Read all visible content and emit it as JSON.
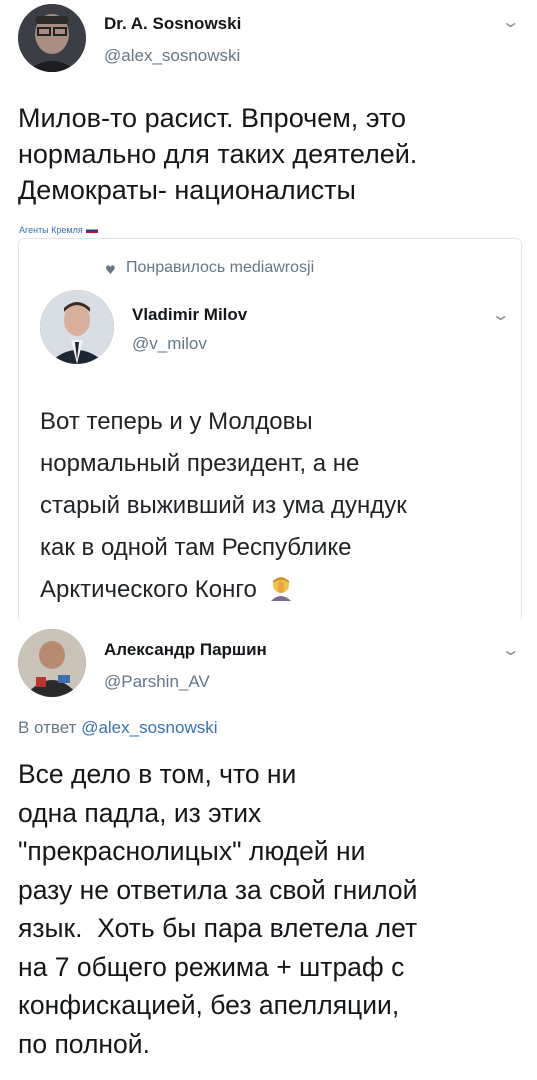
{
  "tweet1": {
    "author_name": "Dr. A. Sosnowski",
    "author_handle": "@alex_sosnowski",
    "text_lines": [
      "Милов-то расист. Впрочем, это",
      "нормально для таких деятелей.",
      "Демократы- националисты"
    ],
    "small_label": "Агенты Кремля"
  },
  "quoted": {
    "liked_by": "Понравилось mediawrosji",
    "author_name": "Vladimir Milov",
    "author_handle": "@v_milov",
    "text_lines": [
      "Вот теперь и у Молдовы",
      "нормальный президент, а не",
      "старый выживший из ума дундук",
      "как в одной там Республике",
      "Арктического Конго"
    ],
    "emoji_name": "facepalm-emoji"
  },
  "reply": {
    "author_name": "Александр Паршин",
    "author_handle": "@Parshin_AV",
    "in_reply_prefix": "В ответ",
    "in_reply_handle": "@alex_sosnowski",
    "text_lines": [
      "Все дело в том, что ни",
      "одна падла, из этих",
      "\"прекраснолицых\" людей ни",
      "разу не ответила за свой гнилой",
      "язык.  Хоть бы пара влетела лет",
      "на 7 общего режима + штраф с",
      "конфискацией, без апелляции,",
      "по полной."
    ]
  },
  "icons": {
    "chevron": "chevron-down-icon",
    "heart": "heart-icon"
  },
  "colors": {
    "text": "#14171a",
    "secondary": "#657786",
    "link": "#3a70b6"
  }
}
